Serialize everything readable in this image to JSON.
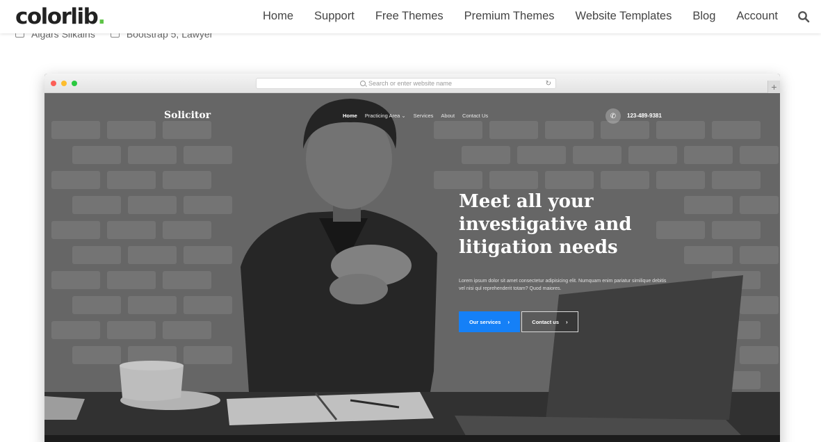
{
  "site": {
    "logo_text": "colorlib",
    "logo_dot": ".",
    "brand_color": "#5ec447",
    "nav": [
      {
        "label": "Home"
      },
      {
        "label": "Support"
      },
      {
        "label": "Free Themes"
      },
      {
        "label": "Premium Themes"
      },
      {
        "label": "Website Templates"
      },
      {
        "label": "Blog"
      },
      {
        "label": "Account"
      }
    ],
    "search_icon": "search-icon"
  },
  "meta": {
    "author": "Aigars Silkalns",
    "categories": "Bootstrap 5, Lawyer"
  },
  "browser": {
    "address_placeholder": "Search or enter website name",
    "new_tab_symbol": "+",
    "reload_symbol": "↻"
  },
  "template": {
    "brand": "Solicitor",
    "nav": [
      {
        "label": "Home"
      },
      {
        "label": "Practicing Area ⌄"
      },
      {
        "label": "Services"
      },
      {
        "label": "About"
      },
      {
        "label": "Contact Us"
      }
    ],
    "phone": "123-489-9381",
    "hero_title": "Meet all your investigative and litigation needs",
    "hero_text": "Lorem ipsum dolor sit amet consectetur adipisicing elit. Numquam enim pariatur similique debitis vel nisi qul reprehenderit totam? Quod maiores.",
    "primary_button": "Our services",
    "secondary_button": "Contact us",
    "accent_color": "#1580f7"
  }
}
